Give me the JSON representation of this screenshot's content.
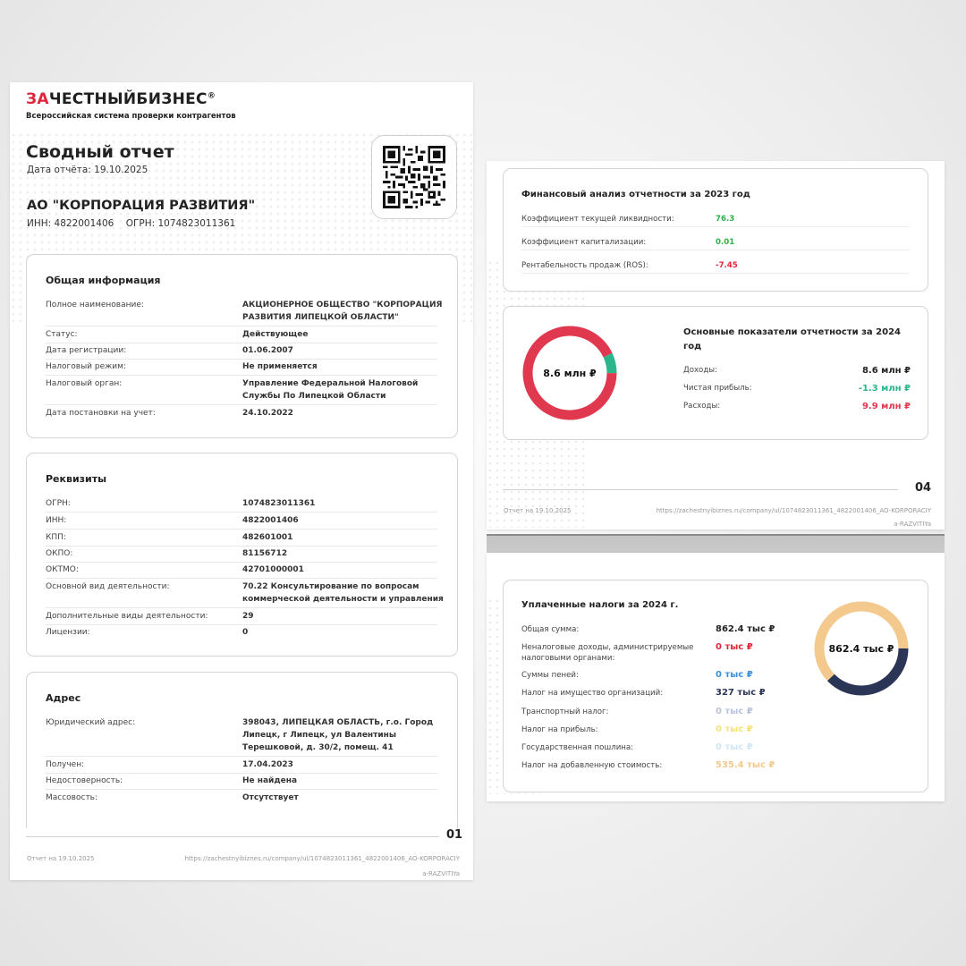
{
  "page1": {
    "logo": {
      "accent": "ЗА",
      "rest": "ЧЕСТНЫЙБИЗНЕС",
      "mark": "®",
      "tagline": "Всероссийская система проверки контрагентов"
    },
    "title": "Сводный отчет",
    "report_date": "Дата отчёта: 19.10.2025",
    "org_name": "АО \"КОРПОРАЦИЯ РАЗВИТИЯ\"",
    "inn_line": "ИНН: 4822001406",
    "ogrn_line": "ОГРН: 1074823011361",
    "general": {
      "title": "Общая информация",
      "rows": [
        {
          "k": "Полное наименование:",
          "v": "АКЦИОНЕРНОЕ ОБЩЕСТВО \"КОРПОРАЦИЯ РАЗВИТИЯ ЛИПЕЦКОЙ ОБЛАСТИ\""
        },
        {
          "k": "Статус:",
          "v": "Действующее"
        },
        {
          "k": "Дата регистрации:",
          "v": "01.06.2007"
        },
        {
          "k": "Налоговый режим:",
          "v": "Не применяется"
        },
        {
          "k": "Налоговый орган:",
          "v": "Управление Федеральной Налоговой Службы По Липецкой Области"
        },
        {
          "k": "Дата постановки на учет:",
          "v": "24.10.2022"
        }
      ]
    },
    "requisites": {
      "title": "Реквизиты",
      "rows": [
        {
          "k": "ОГРН:",
          "v": "1074823011361"
        },
        {
          "k": "ИНН:",
          "v": "4822001406"
        },
        {
          "k": "КПП:",
          "v": "482601001"
        },
        {
          "k": "ОКПО:",
          "v": "81156712"
        },
        {
          "k": "ОКТМО:",
          "v": "42701000001"
        },
        {
          "k": "Основной вид деятельности:",
          "v": "70.22 Консультирование по вопросам коммерческой деятельности и управления"
        },
        {
          "k": "Дополнительные виды деятельности:",
          "v": "29"
        },
        {
          "k": "Лицензии:",
          "v": "0"
        }
      ]
    },
    "address": {
      "title": "Адрес",
      "rows": [
        {
          "k": "Юридический адрес:",
          "v": "398043, ЛИПЕЦКАЯ ОБЛАСТЬ, г.о. Город Липецк, г Липецк, ул Валентины Терешковой, д. 30/2, помещ. 41"
        },
        {
          "k": "Получен:",
          "v": "17.04.2023"
        },
        {
          "k": "Недостоверность:",
          "v": "Не найдена"
        },
        {
          "k": "Массовость:",
          "v": "Отсутствует"
        }
      ]
    },
    "footer": {
      "page": "01",
      "date": "Отчет на 19.10.2025",
      "url1": "https://zachestnyibiznes.ru/company/ul/1074823011361_4822001406_AO-KORPORACIY",
      "url2": "a-RAZVITIYa"
    }
  },
  "page2": {
    "fin": {
      "title": "Финансовый анализ отчетности за 2023 год",
      "rows": [
        {
          "k": "Коэффициент текущей ликвидности:",
          "v": "76.3",
          "color": "#2fae4a"
        },
        {
          "k": "Коэффициент капитализации:",
          "v": "0.01",
          "color": "#2fae4a"
        },
        {
          "k": "Рентабельность продаж (ROS):",
          "v": "-7.45",
          "color": "#e0263a"
        }
      ]
    },
    "main": {
      "title": "Основные показатели отчетности за 2024 год",
      "center": "8.6 млн ₽",
      "rows": [
        {
          "k": "Доходы:",
          "v": "8.6 млн ₽",
          "color": "#222222"
        },
        {
          "k": "Чистая прибыль:",
          "v": "-1.3 млн ₽",
          "color": "#2bb58a"
        },
        {
          "k": "Расходы:",
          "v": "9.9 млн ₽",
          "color": "#e0384e"
        }
      ]
    },
    "footer": {
      "page": "04",
      "date": "Отчет на 19.10.2025",
      "url1": "https://zachestnyibiznes.ru/company/ul/1074823011361_4822001406_AO-KORPORACIY",
      "url2": "a-RAZVITIYa"
    }
  },
  "page3": {
    "taxes": {
      "title": "Уплаченные налоги за 2024 г.",
      "center": "862.4 тыс ₽",
      "rows": [
        {
          "k": "Общая сумма:",
          "v": "862.4 тыс ₽",
          "color": "#222222"
        },
        {
          "k": "Неналоговые доходы, администрируемые налоговыми органами:",
          "v": "0 тыс ₽",
          "color": "#e0263a"
        },
        {
          "k": "Суммы пеней:",
          "v": "0 тыс ₽",
          "color": "#3b8fd9"
        },
        {
          "k": "Налог на имущество организаций:",
          "v": "327 тыс ₽",
          "color": "#2b3556"
        },
        {
          "k": "Транспортный налог:",
          "v": "0 тыс ₽",
          "color": "#b9c2dd"
        },
        {
          "k": "Налог на прибыль:",
          "v": "0 тыс ₽",
          "color": "#f4e27a"
        },
        {
          "k": "Государственная пошлина:",
          "v": "0 тыс ₽",
          "color": "#cfe7f3"
        },
        {
          "k": "Налог на добавленную стоимость:",
          "v": "535.4 тыс ₽",
          "color": "#f3c98d"
        }
      ]
    }
  },
  "chart_data": [
    {
      "type": "pie",
      "title": "Основные показатели отчетности за 2024 год",
      "categories": [
        "Доходы",
        "Чистая прибыль",
        "Расходы"
      ],
      "values": [
        8.6,
        -1.3,
        9.9
      ],
      "colors": [
        "#e0384e",
        "#2bb58a",
        "#e0384e"
      ]
    },
    {
      "type": "pie",
      "title": "Уплаченные налоги за 2024 г.",
      "categories": [
        "Налог на имущество организаций",
        "Налог на добавленную стоимость"
      ],
      "values": [
        327,
        535.4
      ],
      "colors": [
        "#2b3556",
        "#f3c98d"
      ]
    }
  ]
}
